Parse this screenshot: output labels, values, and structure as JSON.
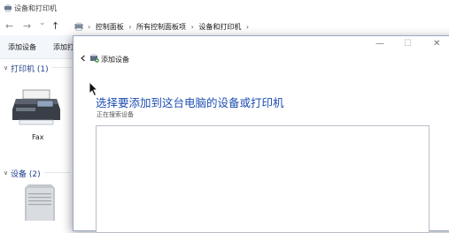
{
  "background_window": {
    "title": "设备和打印机",
    "nav": {
      "back": "←",
      "forward": "→",
      "dropdown": "⌄",
      "up": "↑"
    },
    "breadcrumb": {
      "separator": "›",
      "items": [
        "控制面板",
        "所有控制面板项",
        "设备和打印机"
      ]
    },
    "toolbar": {
      "add_device": "添加设备",
      "add_printer_partial": "添加打"
    },
    "groups": {
      "printers": {
        "chevron": "∨",
        "header": "打印机 (1)",
        "items": [
          {
            "label": "Fax"
          }
        ]
      },
      "devices": {
        "chevron": "∨",
        "header": "设备 (2)"
      }
    }
  },
  "dialog": {
    "title": "添加设备",
    "controls": {
      "minimize": "—",
      "maximize": "☐",
      "close": "✕"
    },
    "heading": "选择要添加到这台电脑的设备或打印机",
    "status": "正在搜索设备"
  }
}
